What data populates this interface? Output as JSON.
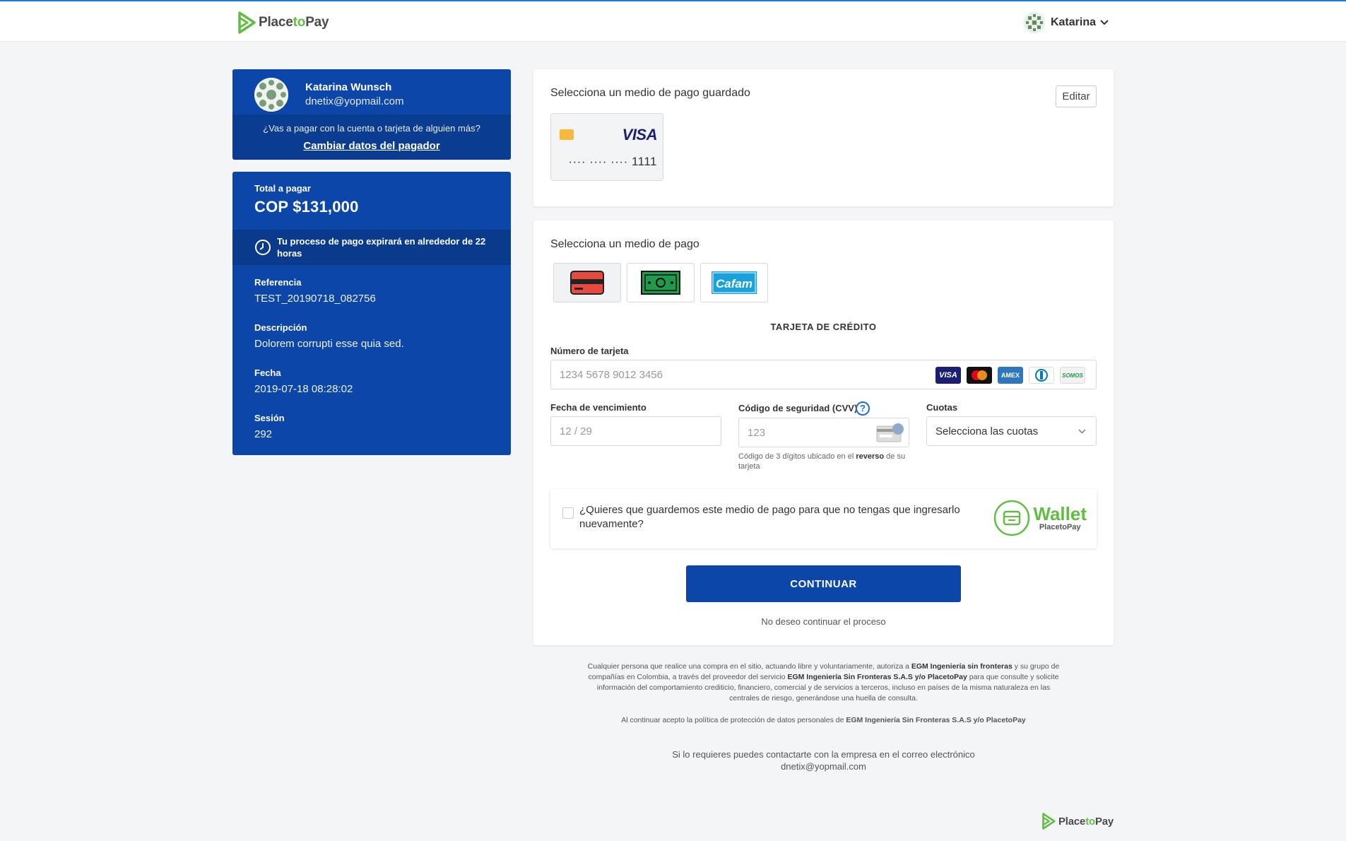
{
  "header": {
    "brand_prefix": "Place",
    "brand_to": "to",
    "brand_suffix": "Pay",
    "user_name": "Katarina"
  },
  "payer": {
    "name": "Katarina Wunsch",
    "email": "dnetix@yopmail.com",
    "question": "¿Vas a pagar con la cuenta o tarjeta de alguien más?",
    "change_link": "Cambiar datos del pagador"
  },
  "summary": {
    "total_label": "Total a pagar",
    "total_value": "COP $131,000",
    "expire_text": "Tu proceso de pago expirará en alrededor de 22 horas",
    "details": [
      {
        "label": "Referencia",
        "value": "TEST_20190718_082756"
      },
      {
        "label": "Descripción",
        "value": "Dolorem corrupti esse quia sed."
      },
      {
        "label": "Fecha",
        "value": "2019-07-18 08:28:02"
      },
      {
        "label": "Sesión",
        "value": "292"
      }
    ]
  },
  "saved": {
    "title": "Selecciona un medio de pago guardado",
    "edit_label": "Editar",
    "card_brand": "VISA",
    "card_masked": "···· ···· ···· 1111"
  },
  "payment": {
    "title": "Selecciona un medio de pago",
    "methods": [
      "credit-card",
      "cash",
      "cafam"
    ],
    "cafam_label": "Cafam",
    "section_heading": "TARJETA DE CRÉDITO",
    "card_number_label": "Número de tarjeta",
    "card_number_placeholder": "1234 5678 9012 3456",
    "brands": [
      "VISA",
      "MC",
      "AMEX",
      "DINERS",
      "SOMOS"
    ],
    "expiry_label": "Fecha de vencimiento",
    "expiry_placeholder": "12 / 29",
    "cvv_label": "Código de seguridad (CVV)",
    "cvv_placeholder": "123",
    "cvv_hint_pre": "Código de 3 dígitos ubicado en el ",
    "cvv_hint_bold": "reverso",
    "cvv_hint_post": " de su tarjeta",
    "installments_label": "Cuotas",
    "installments_value": "Selecciona las cuotas",
    "save_text": "¿Quieres que guardemos este medio de pago para que no tengas que ingresarlo nuevamente?",
    "wallet_word": "Wallet",
    "wallet_sub": "PlacetoPay",
    "continue_label": "CONTINUAR",
    "cancel_label": "No deseo continuar el proceso"
  },
  "footer": {
    "legal_1": "Cualquier persona que realice una compra en el sitio, actuando libre y voluntariamente, autoriza a ",
    "legal_b1": "EGM Ingeniería sin fronteras",
    "legal_2": " y su grupo de compañías en Colombia, a través del proveedor del servicio ",
    "legal_b2": "EGM Ingeniería Sin Fronteras S.A.S y/o PlacetoPay",
    "legal_3": " para que consulte y solicite información del comportamiento crediticio, financiero, comercial y de servicios a terceros, incluso en países de la misma naturaleza en las centrales de riesgo, generándose una huella de consulta.",
    "privacy_pre": "Al continuar acepto la política de protección de datos personales de ",
    "privacy_bold": "EGM Ingeniería Sin Fronteras S.A.S y/o PlacetoPay",
    "contact_line": "Si lo requieres puedes contactarte con la empresa en el correo electrónico",
    "contact_email": "dnetix@yopmail.com"
  }
}
